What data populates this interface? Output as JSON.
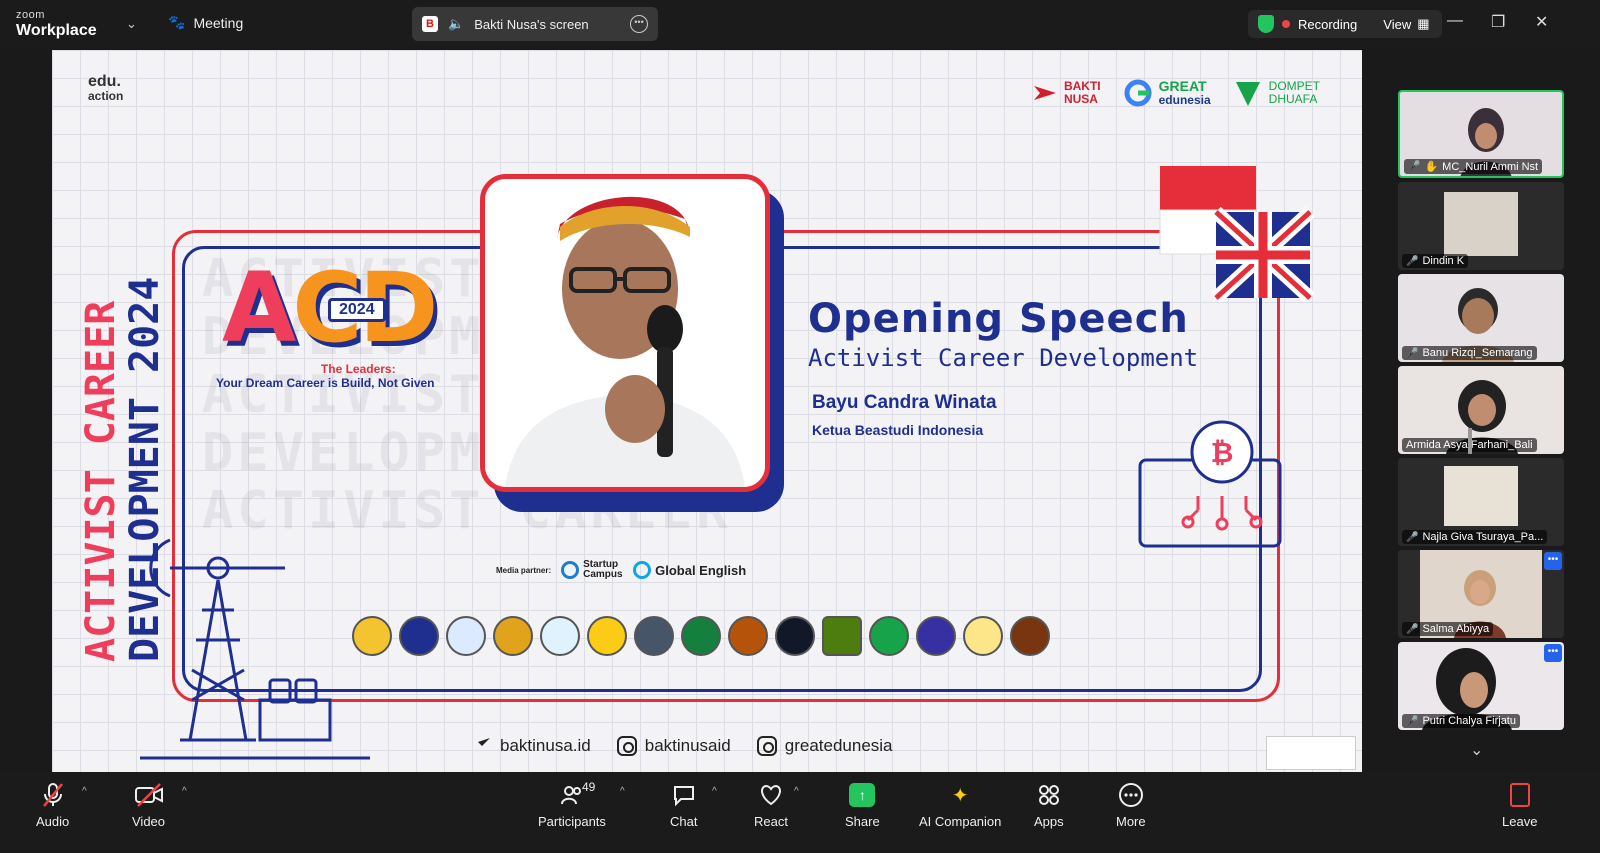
{
  "app": {
    "brand_top": "zoom",
    "brand_bottom": "Workplace",
    "meeting_label": "Meeting"
  },
  "share_pill": {
    "label": "Bakti Nusa's screen"
  },
  "recording": {
    "label": "Recording",
    "view_label": "View"
  },
  "slide": {
    "edu_line1": "edu.",
    "edu_line2": "action",
    "sponsors": [
      {
        "line1": "BAKTI",
        "line2": "NUSA",
        "color": "#d11f2e"
      },
      {
        "line1": "GREAT",
        "line2": "edunesia",
        "color": "#16a34a"
      },
      {
        "line1": "DOMPET",
        "line2": "DHUAFA",
        "color": "#16a34a"
      }
    ],
    "vertical_line1": "ACTIVIST CAREER",
    "vertical_line2": "DEVELOPMENT 2024",
    "bg_lines": [
      "ACTIVIST CAREER",
      "DEVELOPMENT 2024",
      "ACTIVIST",
      "DEVELOPMENT 2024",
      "ACTIVIST CAREER"
    ],
    "acd_letters_a": "A",
    "acd_letters_cd": "CD",
    "acd_year": "2024",
    "tagline1": "The Leaders:",
    "tagline2": "Your Dream Career is Build, Not Given",
    "title": "Opening Speech",
    "subtitle": "Activist Career Development",
    "speaker_name": "Bayu Candra Winata",
    "speaker_role": "Ketua Beastudi Indonesia",
    "media_label": "Media partner:",
    "media_partners": [
      "Startup Campus",
      "Global English"
    ],
    "footer": [
      {
        "label": "baktinusa.id",
        "icon": "cursor-icon"
      },
      {
        "label": "baktinusaid",
        "icon": "instagram-icon"
      },
      {
        "label": "greatedunesia",
        "icon": "instagram-icon"
      }
    ]
  },
  "participants": [
    {
      "name": "MC_Nuril Ammi Nst",
      "speaking": true,
      "tone": "#d9cbd1"
    },
    {
      "name": "Dindin K",
      "speaking": false,
      "tone": "#c9c2b5"
    },
    {
      "name": "Banu Rizqi_Semarang",
      "speaking": false,
      "tone": "#c7c3c8"
    },
    {
      "name": "Armida Asya Farhani_Bali",
      "speaking": false,
      "tone": "#cfc6c4"
    },
    {
      "name": "Najla Giva Tsuraya_Pa...",
      "speaking": false,
      "tone": "#c9c5c0"
    },
    {
      "name": "Salma Abiyya",
      "speaking": false,
      "tone": "#d8cdc2"
    },
    {
      "name": "Putri Chalya Firjatu",
      "speaking": false,
      "tone": "#cdc8cc"
    }
  ],
  "toolbar": {
    "audio": "Audio",
    "video": "Video",
    "participants": "Participants",
    "participants_count": "49",
    "chat": "Chat",
    "react": "React",
    "share": "Share",
    "ai": "AI Companion",
    "apps": "Apps",
    "more": "More",
    "leave": "Leave"
  },
  "colors": {
    "accent_red": "#e62e3b",
    "accent_navy": "#1e2f8f",
    "share_green": "#22c55e"
  }
}
